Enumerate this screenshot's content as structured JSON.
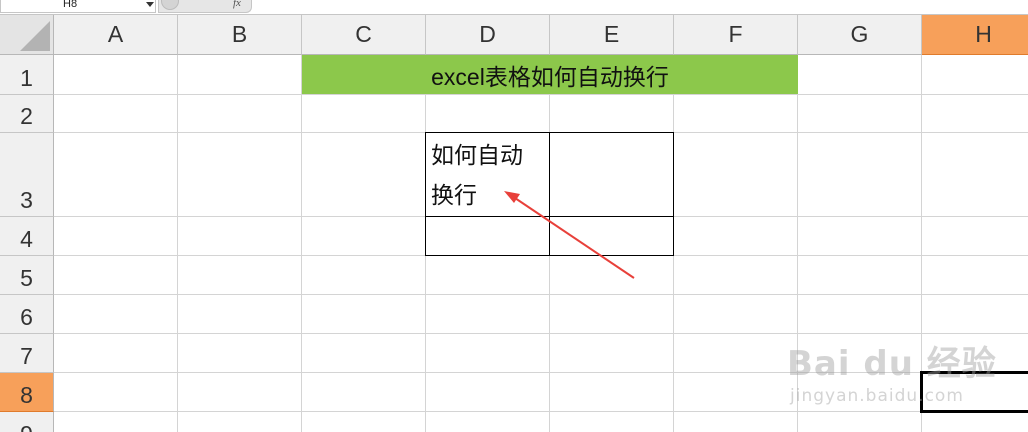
{
  "formula_bar": {
    "name_box": "H8",
    "fx_label": "fx"
  },
  "columns": [
    {
      "label": "A",
      "active": false
    },
    {
      "label": "B",
      "active": false
    },
    {
      "label": "C",
      "active": false
    },
    {
      "label": "D",
      "active": false
    },
    {
      "label": "E",
      "active": false
    },
    {
      "label": "F",
      "active": false
    },
    {
      "label": "G",
      "active": false
    },
    {
      "label": "H",
      "active": true
    }
  ],
  "rows": [
    {
      "label": "1",
      "active": false
    },
    {
      "label": "2",
      "active": false
    },
    {
      "label": "3",
      "active": false
    },
    {
      "label": "4",
      "active": false
    },
    {
      "label": "5",
      "active": false
    },
    {
      "label": "6",
      "active": false
    },
    {
      "label": "7",
      "active": false
    },
    {
      "label": "8",
      "active": true
    },
    {
      "label": "9",
      "active": false
    }
  ],
  "cells": {
    "title": "excel表格如何自动换行",
    "d3_line1": "如何自动",
    "d3_line2": "换行"
  },
  "colors": {
    "title_fill": "#8cc84b",
    "active_header": "#f7a05a",
    "arrow": "#e8403a"
  },
  "watermark": {
    "line1": "Bai du 经验",
    "line2": "jingyan.baidu.com"
  }
}
